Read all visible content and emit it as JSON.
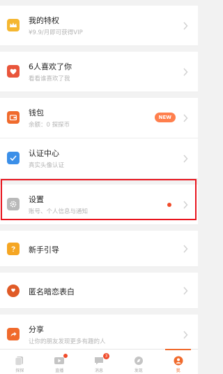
{
  "menu": {
    "privilege": {
      "icon": "crown-icon",
      "title": "我的特权",
      "subtitle": "¥9.9/月即可获得VIP"
    },
    "likes": {
      "icon": "heart-icon",
      "title": "6人喜欢了你",
      "subtitle": "看看谁喜欢了我"
    },
    "wallet": {
      "icon": "wallet-icon",
      "title": "钱包",
      "subtitle": "余额：0 探探币",
      "badge": "NEW"
    },
    "verify": {
      "icon": "check-icon",
      "title": "认证中心",
      "subtitle": "真实头像认证"
    },
    "settings": {
      "icon": "gear-icon",
      "title": "设置",
      "subtitle": "账号、个人信息与通知"
    },
    "guide": {
      "icon": "question-icon",
      "title": "新手引导"
    },
    "anonymous": {
      "icon": "speech-bubble-icon",
      "title": "匿名暗恋表白"
    },
    "share": {
      "icon": "share-icon",
      "title": "分享",
      "subtitle": "让你的朋友发现更多有趣的人"
    }
  },
  "tabs": [
    {
      "label": "探探",
      "icon": "cards-icon"
    },
    {
      "label": "直播",
      "icon": "video-icon"
    },
    {
      "label": "消息",
      "icon": "chat-icon",
      "count": "3"
    },
    {
      "label": "发现",
      "icon": "compass-icon"
    },
    {
      "label": "我",
      "icon": "profile-icon"
    }
  ],
  "colors": {
    "accent": "#f06a2c",
    "highlight": "#e8141d",
    "privilege_icon": "#f5b731",
    "likes_icon": "#e9553b",
    "wallet_icon": "#f06a2c",
    "verify_icon": "#3b8fe8",
    "settings_icon": "#b9b9b9",
    "guide_icon": "#f5a623",
    "anonymous_icon": "#e05a26",
    "share_icon": "#f06a2c"
  }
}
